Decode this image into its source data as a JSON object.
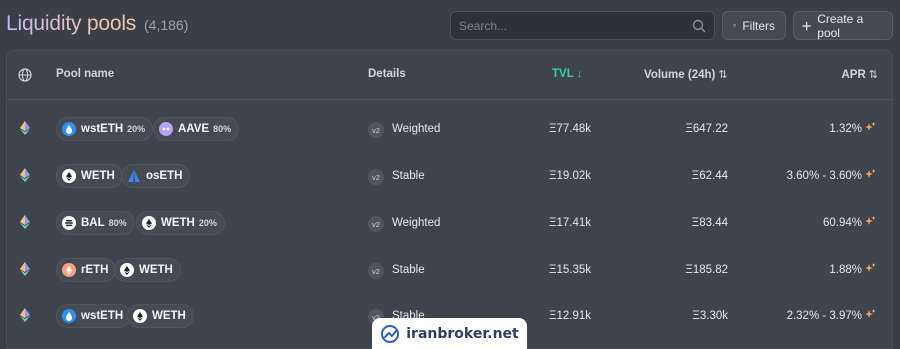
{
  "header": {
    "title": "Liquidity pools",
    "count": "(4,186)",
    "search_placeholder": "Search...",
    "filters_label": "Filters",
    "create_label": "Create a pool"
  },
  "columns": {
    "network_icon": "globe-icon",
    "pool_name": "Pool name",
    "details": "Details",
    "tvl": "TVL",
    "tvl_sort": "↓",
    "volume": "Volume (24h)",
    "volume_sort": "⇅",
    "apr": "APR",
    "apr_sort": "⇅"
  },
  "colors": {
    "accent_green": "#34d399",
    "spark_orange": "#f59e5b"
  },
  "rows": [
    {
      "tokens": [
        {
          "symbol": "wstETH",
          "weight": "20%",
          "icon": "wsteth-icon"
        },
        {
          "symbol": "AAVE",
          "weight": "80%",
          "icon": "aave-icon"
        }
      ],
      "version": "v2",
      "type": "Weighted",
      "tvl": "Ξ77.48k",
      "volume": "Ξ647.22",
      "apr": "1.32%"
    },
    {
      "tokens": [
        {
          "symbol": "WETH",
          "weight": "",
          "icon": "weth-icon"
        },
        {
          "symbol": "osETH",
          "weight": "",
          "icon": "oseth-icon"
        }
      ],
      "version": "v2",
      "type": "Stable",
      "tvl": "Ξ19.02k",
      "volume": "Ξ62.44",
      "apr": "3.60% - 3.60%"
    },
    {
      "tokens": [
        {
          "symbol": "BAL",
          "weight": "80%",
          "icon": "bal-icon"
        },
        {
          "symbol": "WETH",
          "weight": "20%",
          "icon": "weth-icon"
        }
      ],
      "version": "v2",
      "type": "Weighted",
      "tvl": "Ξ17.41k",
      "volume": "Ξ83.44",
      "apr": "60.94%"
    },
    {
      "tokens": [
        {
          "symbol": "rETH",
          "weight": "",
          "icon": "reth-icon"
        },
        {
          "symbol": "WETH",
          "weight": "",
          "icon": "weth-icon"
        }
      ],
      "version": "v2",
      "type": "Stable",
      "tvl": "Ξ15.35k",
      "volume": "Ξ185.82",
      "apr": "1.88%"
    },
    {
      "tokens": [
        {
          "symbol": "wstETH",
          "weight": "",
          "icon": "wsteth-icon"
        },
        {
          "symbol": "WETH",
          "weight": "",
          "icon": "weth-icon"
        }
      ],
      "version": "v2",
      "type": "Stable",
      "tvl": "Ξ12.91k",
      "volume": "Ξ3.30k",
      "apr": "2.32% - 3.97%"
    }
  ],
  "watermark": {
    "text": "iranbroker.net"
  }
}
